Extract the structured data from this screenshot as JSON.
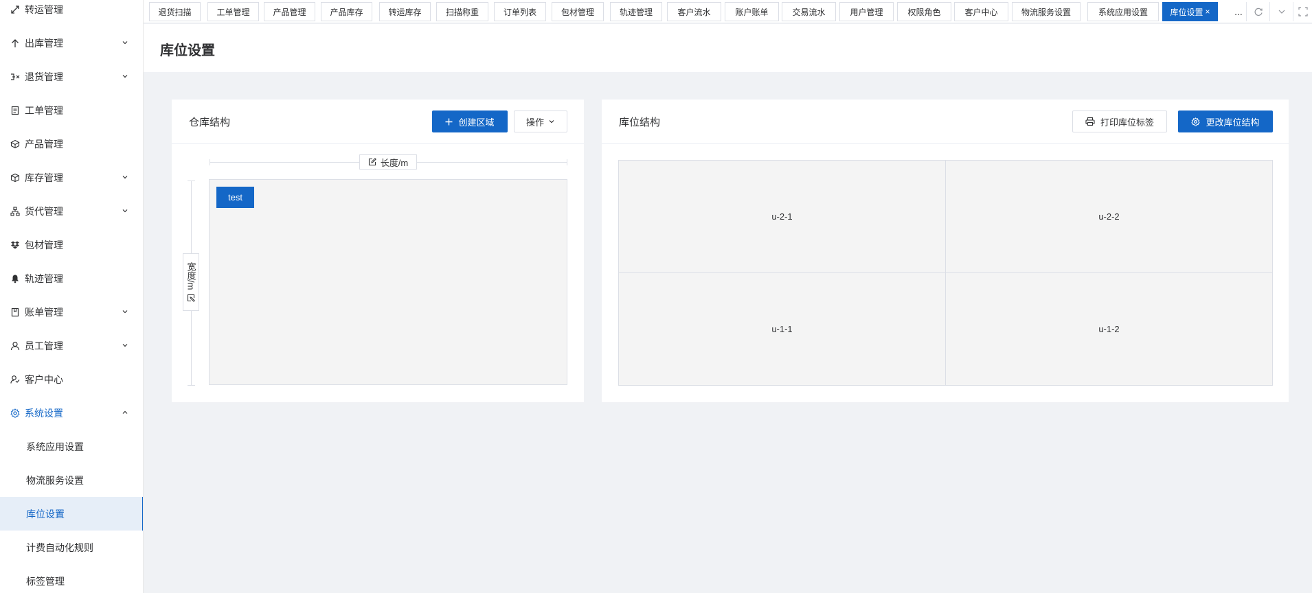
{
  "sidebar": {
    "items": [
      {
        "label": "转运管理",
        "icon": "transfer-icon",
        "has_arrow": false
      },
      {
        "label": "出库管理",
        "icon": "arrow-up-icon",
        "has_arrow": true
      },
      {
        "label": "退货管理",
        "icon": "return-icon",
        "has_arrow": true
      },
      {
        "label": "工单管理",
        "icon": "document-icon",
        "has_arrow": false
      },
      {
        "label": "产品管理",
        "icon": "cube-icon",
        "has_arrow": false
      },
      {
        "label": "库存管理",
        "icon": "box-icon",
        "has_arrow": true
      },
      {
        "label": "货代管理",
        "icon": "org-chart-icon",
        "has_arrow": true
      },
      {
        "label": "包材管理",
        "icon": "dropbox-icon",
        "has_arrow": false
      },
      {
        "label": "轨迹管理",
        "icon": "bell-icon",
        "has_arrow": false
      },
      {
        "label": "账单管理",
        "icon": "book-icon",
        "has_arrow": true
      },
      {
        "label": "员工管理",
        "icon": "user-icon",
        "has_arrow": true
      },
      {
        "label": "客户中心",
        "icon": "customer-icon",
        "has_arrow": false
      },
      {
        "label": "系统设置",
        "icon": "gear-icon",
        "has_arrow": true,
        "expanded": true
      }
    ],
    "sub_items": [
      {
        "label": "系统应用设置"
      },
      {
        "label": "物流服务设置"
      },
      {
        "label": "库位设置",
        "selected": true
      },
      {
        "label": "计费自动化规则"
      },
      {
        "label": "标签管理"
      }
    ]
  },
  "tabs": [
    {
      "label": "退货扫描"
    },
    {
      "label": "工单管理"
    },
    {
      "label": "产品管理"
    },
    {
      "label": "产品库存"
    },
    {
      "label": "转运库存"
    },
    {
      "label": "扫描称重"
    },
    {
      "label": "订单列表"
    },
    {
      "label": "包材管理"
    },
    {
      "label": "轨迹管理"
    },
    {
      "label": "客户流水"
    },
    {
      "label": "账户账单"
    },
    {
      "label": "交易流水"
    },
    {
      "label": "用户管理"
    },
    {
      "label": "权限角色"
    },
    {
      "label": "客户中心"
    },
    {
      "label": "物流服务设置"
    },
    {
      "label": "系统应用设置"
    },
    {
      "label": "库位设置",
      "active": true,
      "close": "×"
    }
  ],
  "tab_more": "...",
  "page": {
    "title": "库位设置"
  },
  "warehouse_card": {
    "title": "仓库结构",
    "create_btn": "创建区域",
    "ops_btn": "操作",
    "length_label": "长度/m",
    "width_label": "宽度/m",
    "zones": [
      {
        "label": "test"
      }
    ]
  },
  "location_card": {
    "title": "库位结构",
    "print_btn": "打印库位标签",
    "change_btn": "更改库位结构",
    "cells": [
      {
        "label": "u-2-1"
      },
      {
        "label": "u-2-2"
      },
      {
        "label": "u-1-1"
      },
      {
        "label": "u-1-2"
      }
    ]
  },
  "colors": {
    "primary": "#1467c7",
    "page_bg": "#f0f2f5"
  }
}
